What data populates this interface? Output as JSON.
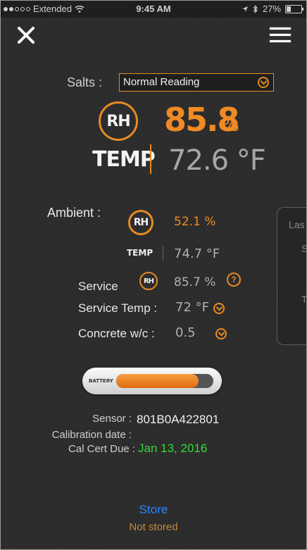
{
  "status_bar": {
    "carrier": "Extended",
    "time": "9:45 AM",
    "battery_percent": "27%",
    "icons": [
      "wifi-icon",
      "location-icon",
      "bluetooth-icon",
      "battery-icon"
    ]
  },
  "header": {
    "close_icon": "close-icon",
    "menu_icon": "hamburger-menu-icon"
  },
  "salts": {
    "label": "Salts :",
    "selected": "Normal Reading"
  },
  "main_reading": {
    "rh_badge": "RH",
    "rh_value": "85.8",
    "rh_unit": "%",
    "temp_label": "TEMP",
    "temp_value": "72.6 °F"
  },
  "ambient": {
    "label": "Ambient :",
    "rh_badge": "RH",
    "rh_value": "52.1 %",
    "temp_label": "TEMP",
    "temp_value": "74.7 °F"
  },
  "service": {
    "label": "Service",
    "rh_badge": "RH",
    "rh_value": "85.7 %",
    "help": "?",
    "temp_label": "Service Temp :",
    "temp_value": "72 °F",
    "concrete_label": "Concrete w/c :",
    "concrete_value": "0.5"
  },
  "side_panel": {
    "text1": "Las",
    "text2": "S",
    "text3": "T"
  },
  "battery": {
    "label": "BATTERY",
    "level_percent": 85
  },
  "sensor_info": {
    "sensor_label": "Sensor :",
    "sensor_value": "801B0A422801",
    "calibration_label": "Calibration date :",
    "cert_label": "Cal Cert Due :",
    "cert_value": "Jan 13, 2016"
  },
  "footer": {
    "store_label": "Store",
    "store_status": "Not stored"
  },
  "colors": {
    "accent": "#e58a22",
    "link": "#2e86ff",
    "cert_ok": "#36d93a"
  }
}
